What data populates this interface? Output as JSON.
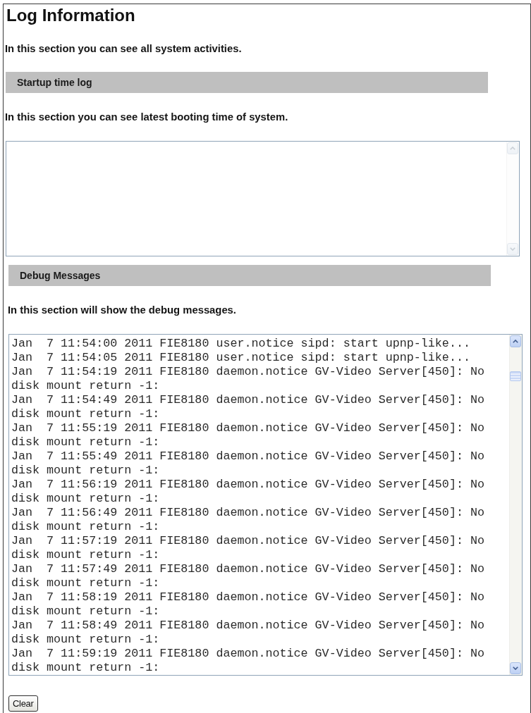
{
  "page": {
    "title": "Log Information",
    "description": "In this section you can see all system activities."
  },
  "sections": [
    {
      "kind": "startup",
      "heading": "Startup time log",
      "description": "In this section you can see latest booting time of system."
    },
    {
      "kind": "debug",
      "heading": "Debug Messages",
      "description": "In this section will show the debug messages.",
      "lines": [
        "Jan  7 11:54:00 2011 FIE8180 user.notice sipd: start upnp-like...",
        "Jan  7 11:54:05 2011 FIE8180 user.notice sipd: start upnp-like...",
        "Jan  7 11:54:19 2011 FIE8180 daemon.notice GV-Video Server[450]: No disk mount return -1:",
        "Jan  7 11:54:49 2011 FIE8180 daemon.notice GV-Video Server[450]: No disk mount return -1:",
        "Jan  7 11:55:19 2011 FIE8180 daemon.notice GV-Video Server[450]: No disk mount return -1:",
        "Jan  7 11:55:49 2011 FIE8180 daemon.notice GV-Video Server[450]: No disk mount return -1:",
        "Jan  7 11:56:19 2011 FIE8180 daemon.notice GV-Video Server[450]: No disk mount return -1:",
        "Jan  7 11:56:49 2011 FIE8180 daemon.notice GV-Video Server[450]: No disk mount return -1:",
        "Jan  7 11:57:19 2011 FIE8180 daemon.notice GV-Video Server[450]: No disk mount return -1:",
        "Jan  7 11:57:49 2011 FIE8180 daemon.notice GV-Video Server[450]: No disk mount return -1:",
        "Jan  7 11:58:19 2011 FIE8180 daemon.notice GV-Video Server[450]: No disk mount return -1:",
        "Jan  7 11:58:49 2011 FIE8180 daemon.notice GV-Video Server[450]: No disk mount return -1:",
        "Jan  7 11:59:19 2011 FIE8180 daemon.notice GV-Video Server[450]: No disk mount return -1:"
      ]
    }
  ],
  "buttons": [
    {
      "label": "Clear"
    }
  ]
}
